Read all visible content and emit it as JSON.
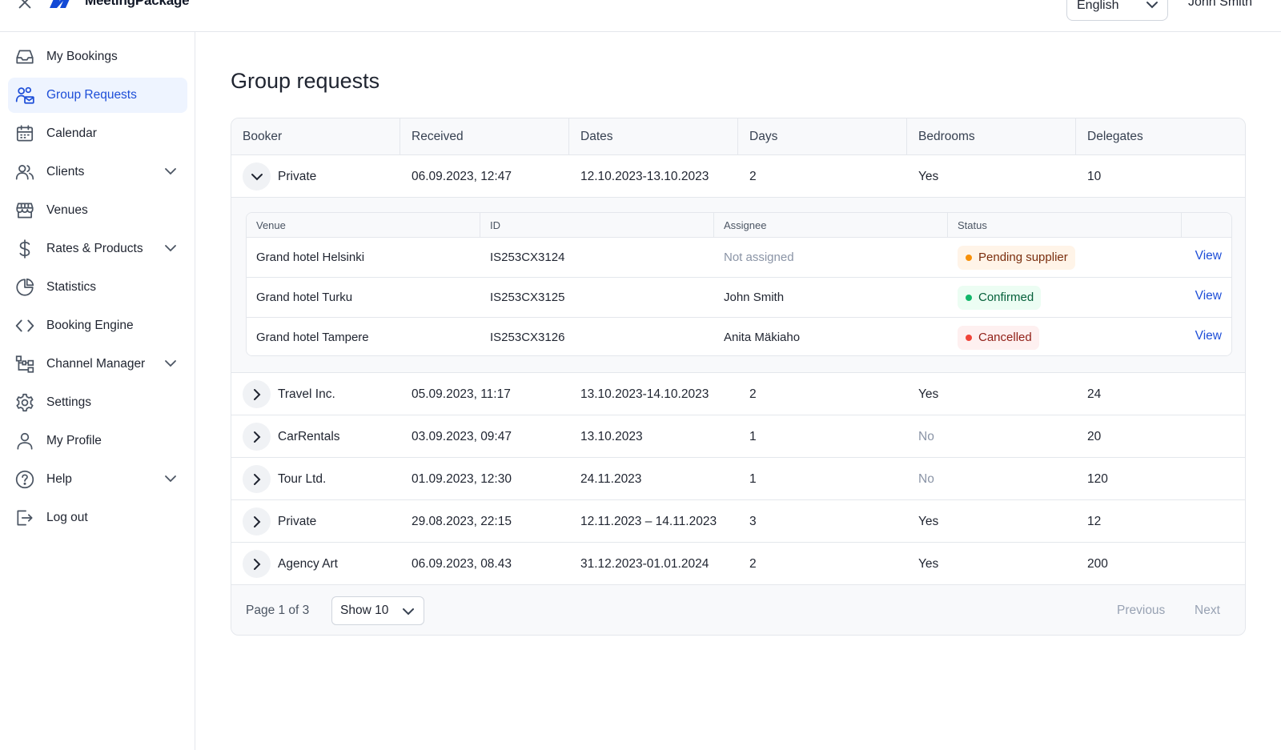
{
  "brand": {
    "name": "MeetingPackage",
    "accent": "#1d4ed8",
    "logo_color": "#1249d6"
  },
  "header": {
    "language": "English",
    "user": "John Smith"
  },
  "sidebar": {
    "items": [
      {
        "label": "My Bookings",
        "icon": "inbox-icon"
      },
      {
        "label": "Group Requests",
        "icon": "users-mail-icon",
        "active": true
      },
      {
        "label": "Calendar",
        "icon": "calendar-icon"
      },
      {
        "label": "Clients",
        "icon": "users-icon",
        "expandable": true
      },
      {
        "label": "Venues",
        "icon": "store-icon"
      },
      {
        "label": "Rates & Products",
        "icon": "dollar-icon",
        "expandable": true
      },
      {
        "label": "Statistics",
        "icon": "pie-chart-icon"
      },
      {
        "label": "Booking Engine",
        "icon": "code-icon"
      },
      {
        "label": "Channel Manager",
        "icon": "hierarchy-icon",
        "expandable": true
      },
      {
        "label": "Settings",
        "icon": "gear-icon"
      },
      {
        "label": "My Profile",
        "icon": "user-icon"
      },
      {
        "label": "Help",
        "icon": "help-circle-icon",
        "expandable": true
      },
      {
        "label": "Log out",
        "icon": "logout-icon"
      }
    ]
  },
  "main": {
    "title": "Group requests",
    "columns": [
      "Booker",
      "Received",
      "Dates",
      "Days",
      "Bedrooms",
      "Delegates"
    ],
    "rows": [
      {
        "booker": "Private",
        "received": "06.09.2023, 12:47",
        "dates": "12.10.2023-13.10.2023",
        "days": "2",
        "bedrooms": "Yes",
        "delegates": "10",
        "expanded": true
      },
      {
        "booker": "Travel Inc.",
        "received": "05.09.2023, 11:17",
        "dates": "13.10.2023-14.10.2023",
        "days": "2",
        "bedrooms": "Yes",
        "delegates": "24"
      },
      {
        "booker": "CarRentals",
        "received": "03.09.2023, 09:47",
        "dates": "13.10.2023",
        "days": "1",
        "bedrooms": "No",
        "delegates": "20"
      },
      {
        "booker": "Tour Ltd.",
        "received": "01.09.2023, 12:30",
        "dates": "24.11.2023",
        "days": "1",
        "bedrooms": "No",
        "delegates": "120"
      },
      {
        "booker": "Private",
        "received": "29.08.2023, 22:15",
        "dates": "12.11.2023 – 14.11.2023",
        "days": "3",
        "bedrooms": "Yes",
        "delegates": "12"
      },
      {
        "booker": "Agency Art",
        "received": "06.09.2023, 08.43",
        "dates": "31.12.2023-01.01.2024",
        "days": "2",
        "bedrooms": "Yes",
        "delegates": "200"
      }
    ],
    "sub": {
      "columns": [
        "Venue",
        "ID",
        "Assignee",
        "Status"
      ],
      "rows": [
        {
          "venue": "Grand hotel Helsinki",
          "id": "IS253CX3124",
          "assignee": "Not assigned",
          "status": "Pending supplier",
          "action": "View"
        },
        {
          "venue": "Grand hotel Turku",
          "id": "IS253CX3125",
          "assignee": "John Smith",
          "status": "Confirmed",
          "action": "View"
        },
        {
          "venue": "Grand hotel Tampere",
          "id": "IS253CX3126",
          "assignee": "Anita Mäkiaho",
          "status": "Cancelled",
          "action": "View"
        }
      ]
    },
    "pagination": {
      "page_info": "Page 1 of 3",
      "show": "Show 10",
      "previous": "Previous",
      "next": "Next"
    }
  }
}
